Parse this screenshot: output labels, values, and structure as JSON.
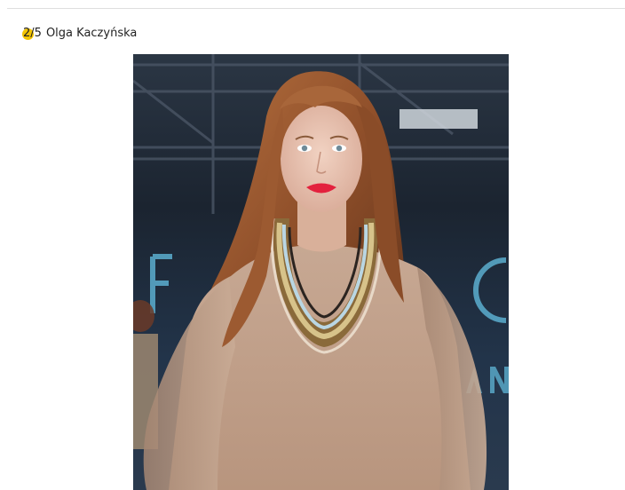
{
  "gallery": {
    "current_index": "2",
    "separator": "/",
    "total_count": "5",
    "caption_name": "Olga Kaczyńska"
  },
  "photo": {
    "alt": "Olga Kaczyńska",
    "background_sign_letters": [
      "F",
      "C",
      "A",
      "N"
    ]
  },
  "colors": {
    "accent_dot": "#f3c400",
    "divider": "#dedede",
    "caption_text": "#222222"
  }
}
